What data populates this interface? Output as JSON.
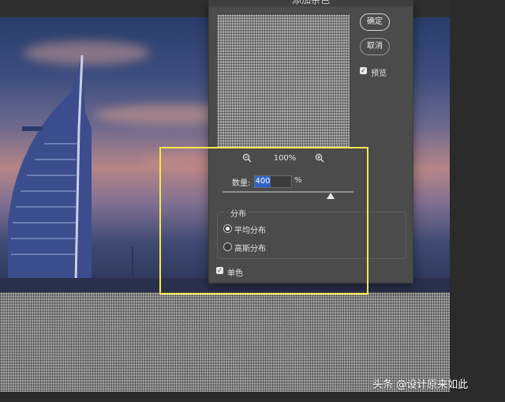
{
  "dialog": {
    "title": "添加杂色",
    "ok_label": "确定",
    "cancel_label": "取消",
    "preview_label": "预览",
    "preview_checked": true,
    "zoom_level": "100%",
    "amount_label": "数量:",
    "amount_value": "400",
    "amount_unit": "%",
    "distribution": {
      "group_label": "分布",
      "options": [
        {
          "label": "平均分布",
          "selected": true
        },
        {
          "label": "高斯分布",
          "selected": false
        }
      ]
    },
    "monochrome_label": "单色",
    "monochrome_checked": true
  },
  "watermark": "头条 @设计原来如此",
  "colors": {
    "dialog_bg": "#4b4b4b",
    "highlight": "#f5e94c",
    "selection": "#2f62c9"
  },
  "icons": [
    "zoom-out-icon",
    "zoom-in-icon",
    "checkmark-icon"
  ]
}
